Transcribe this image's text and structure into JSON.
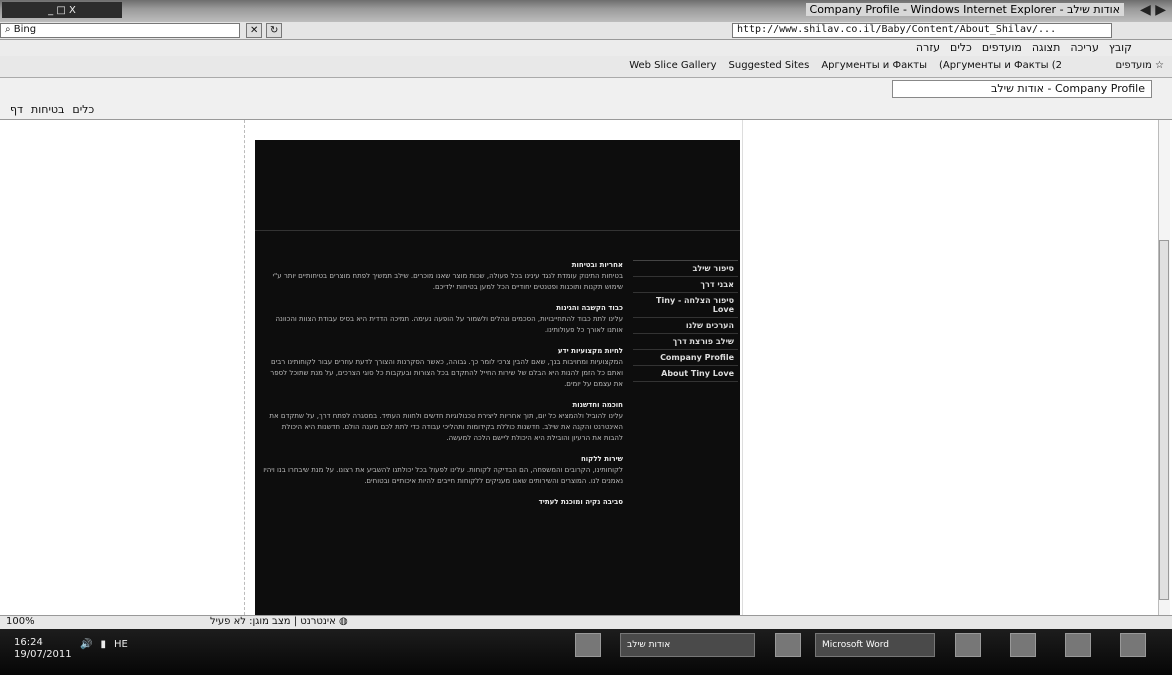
{
  "window": {
    "title": "אודות שילב - Company Profile - Windows Internet Explorer",
    "min_max_close": "_ □ X"
  },
  "address": {
    "url": "http://www.shilav.co.il/Baby/Content/About_Shilav/...",
    "search_placeholder": "Bing"
  },
  "menu": [
    "קובץ",
    "עריכה",
    "תצוגה",
    "מועדפים",
    "כלים",
    "עזרה"
  ],
  "favorites": {
    "label": "מועדפים",
    "links": [
      "Web Slice Gallery",
      "Suggested Sites",
      "Аргументы и Факты",
      "(Аргументы и Факты (2"
    ]
  },
  "tab": {
    "label": "אודות שילב - Company Profile"
  },
  "commandbar": [
    "כלים",
    "בטיחות",
    "דף"
  ],
  "site": {
    "nav": [
      "סיפור שילב",
      "אבני דרך",
      "סיפור הצלחה - Tiny Love",
      "הערכים שלנו",
      "שילב פורצת דרך",
      "Company Profile",
      "About Tiny Love"
    ],
    "sections": [
      {
        "heading": "אחריות ובטיחות",
        "body": "בטיחות התינוק עומדת לנגד עינינו בכל פעולה, שכות מוצר שאנו מוכרים. שילב תמשיך לפתח מוצרים בטיחותיים יותר ע\"י שימוש תקנות ותוכנות ופטנטים יחודיים הכל למען בטיחות ילדיכם."
      },
      {
        "heading": "כבוד הקשבה והגינות",
        "body": "עלינו לתת כבוד להתחייבויות, הסכמים ונהלים ולשמור על הופעה נעימה. תמיכה הדדית היא בסיס עבודת הצוות והכוונה אותנו לאורך כל פעולותינו."
      },
      {
        "heading": "לחיות מקצועיות ידע",
        "body": "המקצועיות ומחויבות בנך, שאם להבין צרכי לומר כך. גבוהה, כאשר הסקרנות והצורך לדעת עוזרים עבור לקוחותינו רבים ואתם כל הזמן להנות היא הבלם של שירות החייל להתקדם בכל הצורות ובעקבות כל סוגי הצרכים, על מנת שתוכל לספר את עצמם על יומים."
      },
      {
        "heading": "חוכמה וחדשנות",
        "body": "עלינו להוביל ולהמציא כל יום, תוך אחריות ליצירת טכנולוגיות חדשים ולחוות העתיד. במסגרה לפתח דרך, על שתקדם את האינטרנט והקנה את שילב. חדשנות כוללת בקידומות ותהליכי עבודה כדי לתת לכם מענה הולם. חדשנות היא היכולת להבות את הרעיון והובילת היא היכולת ליישם הלכה למעשה."
      },
      {
        "heading": "שירות ללקוח",
        "body": "לקוחותינו, הקרובים והמשפחה, הם הבדיקה לקוחות. עלינו לפעול בכל יכולתנו להשביע את רצונו. על מנת שיבחרו בנו ויהיו נאמנים לנו. המוצרים והשירותים שאנו מעניקים ללקוחות חייבים להיות איכותיים ובטוחים."
      },
      {
        "heading": "סביבה נקיה ומוכנת לעתיד",
        "body": ""
      }
    ]
  },
  "status": {
    "zoom": "100%",
    "zone": "אינטרנט | מצב מוגן: לא פעיל"
  },
  "taskbar": {
    "time": "16:24",
    "date": "19/07/2011",
    "lang": "HE",
    "buttons": [
      "אודות שילב",
      "Microsoft Word"
    ]
  }
}
